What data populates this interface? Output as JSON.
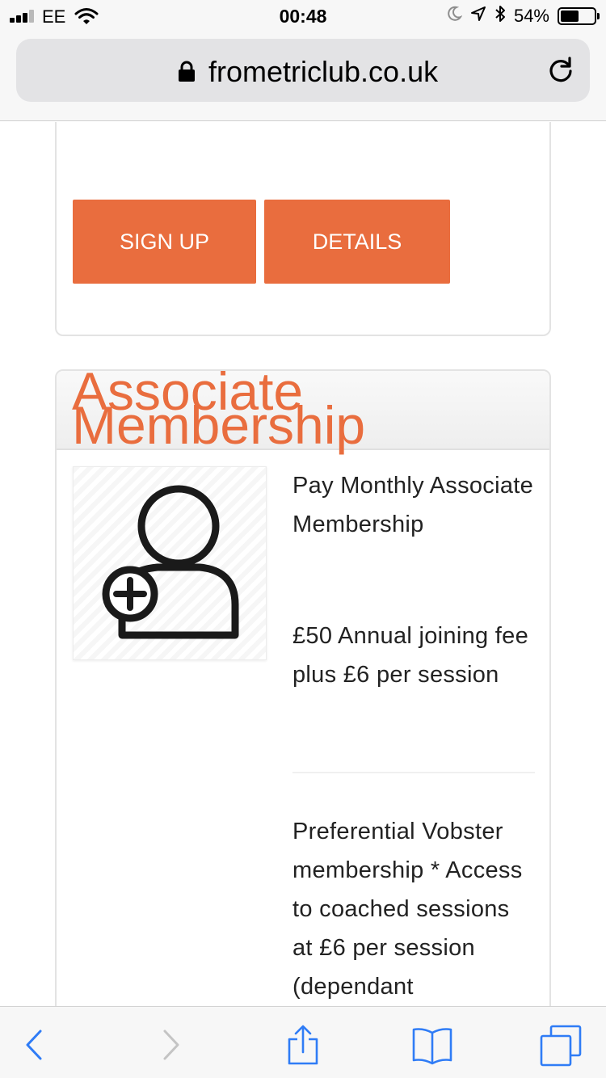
{
  "status_bar": {
    "carrier": "EE",
    "time": "00:48",
    "battery_percent": "54%",
    "battery_level": 0.54,
    "icons": [
      "signal-icon",
      "wifi-icon",
      "moon-icon",
      "location-arrow-icon",
      "bluetooth-icon",
      "battery-icon"
    ]
  },
  "browser": {
    "url": "frometriclub.co.uk",
    "icons": [
      "lock-icon",
      "reload-icon"
    ]
  },
  "top_card": {
    "sign_up_label": "SIGN UP",
    "details_label": "DETAILS"
  },
  "associate_card": {
    "title": "Associate Membership",
    "plan_name": "Pay Monthly Associate Membership",
    "fee": "£50 Annual joining fee plus £6 per session",
    "benefits": "Preferential Vobster membership * Access to coached sessions at £6 per session (dependant",
    "image_icon": "add-user-icon"
  },
  "toolbar": {
    "icons": [
      "back-icon",
      "forward-icon",
      "share-icon",
      "bookmarks-icon",
      "tabs-icon"
    ]
  },
  "colors": {
    "accent": "#e96d3e",
    "ios_blue": "#2f7cf6",
    "text": "#222222",
    "border": "#e3e3e3"
  }
}
